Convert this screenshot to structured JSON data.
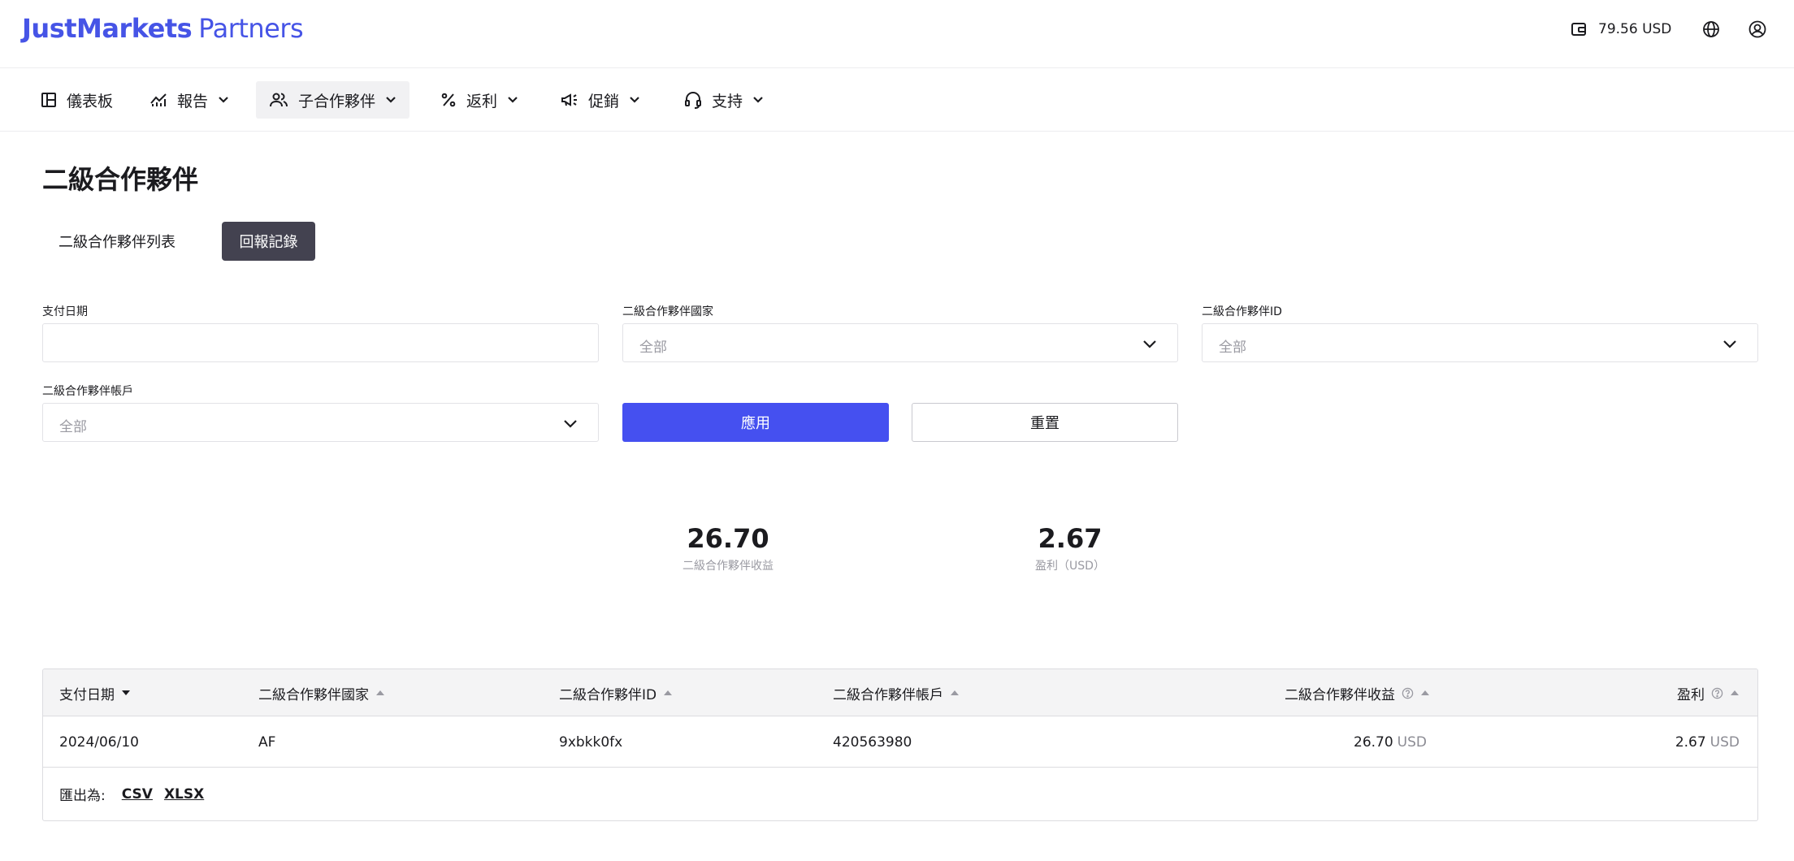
{
  "header": {
    "logo_brand": "JustMarkets",
    "logo_suffix": "Partners",
    "balance": "79.56 USD",
    "icons": [
      "wallet-icon",
      "globe-icon",
      "user-circle-icon"
    ]
  },
  "nav": {
    "items": [
      {
        "label": "儀表板",
        "icon": "dashboard-icon",
        "has_dropdown": false
      },
      {
        "label": "報告",
        "icon": "chart-icon",
        "has_dropdown": true
      },
      {
        "label": "子合作夥伴",
        "icon": "users-icon",
        "has_dropdown": true,
        "active": true
      },
      {
        "label": "返利",
        "icon": "percent-icon",
        "has_dropdown": true
      },
      {
        "label": "促銷",
        "icon": "megaphone-icon",
        "has_dropdown": true
      },
      {
        "label": "支持",
        "icon": "headset-icon",
        "has_dropdown": true
      }
    ]
  },
  "page": {
    "title": "二級合作夥伴",
    "tabs": [
      {
        "label": "二級合作夥伴列表",
        "active": false
      },
      {
        "label": "回報記錄",
        "active": true
      }
    ]
  },
  "filters": {
    "payment_date": {
      "label": "支付日期",
      "value": ""
    },
    "country": {
      "label": "二級合作夥伴國家",
      "value": "全部"
    },
    "partner_id": {
      "label": "二級合作夥伴ID",
      "value": "全部"
    },
    "account": {
      "label": "二級合作夥伴帳戶",
      "value": "全部"
    },
    "apply_label": "應用",
    "reset_label": "重置"
  },
  "summary": {
    "revenue": {
      "value": "26.70",
      "label": "二級合作夥伴收益"
    },
    "profit": {
      "value": "2.67",
      "label": "盈利（USD）"
    }
  },
  "table": {
    "columns": [
      {
        "label": "支付日期",
        "sort": "desc"
      },
      {
        "label": "二級合作夥伴國家",
        "sort": "asc"
      },
      {
        "label": "二級合作夥伴ID",
        "sort": "asc"
      },
      {
        "label": "二級合作夥伴帳戶",
        "sort": "asc"
      },
      {
        "label": "二級合作夥伴收益",
        "sort": "asc",
        "help": true
      },
      {
        "label": "盈利",
        "sort": "asc",
        "help": true
      }
    ],
    "rows": [
      {
        "date": "2024/06/10",
        "country": "AF",
        "id": "9xbkk0fx",
        "account": "420563980",
        "revenue": "26.70",
        "revenue_unit": "USD",
        "profit": "2.67",
        "profit_unit": "USD"
      }
    ],
    "export_label": "匯出為:",
    "export_csv": "CSV",
    "export_xlsx": "XLSX"
  },
  "colors": {
    "brand": "#4654e6",
    "apply_button": "#4550f0",
    "active_tab": "#434250"
  }
}
